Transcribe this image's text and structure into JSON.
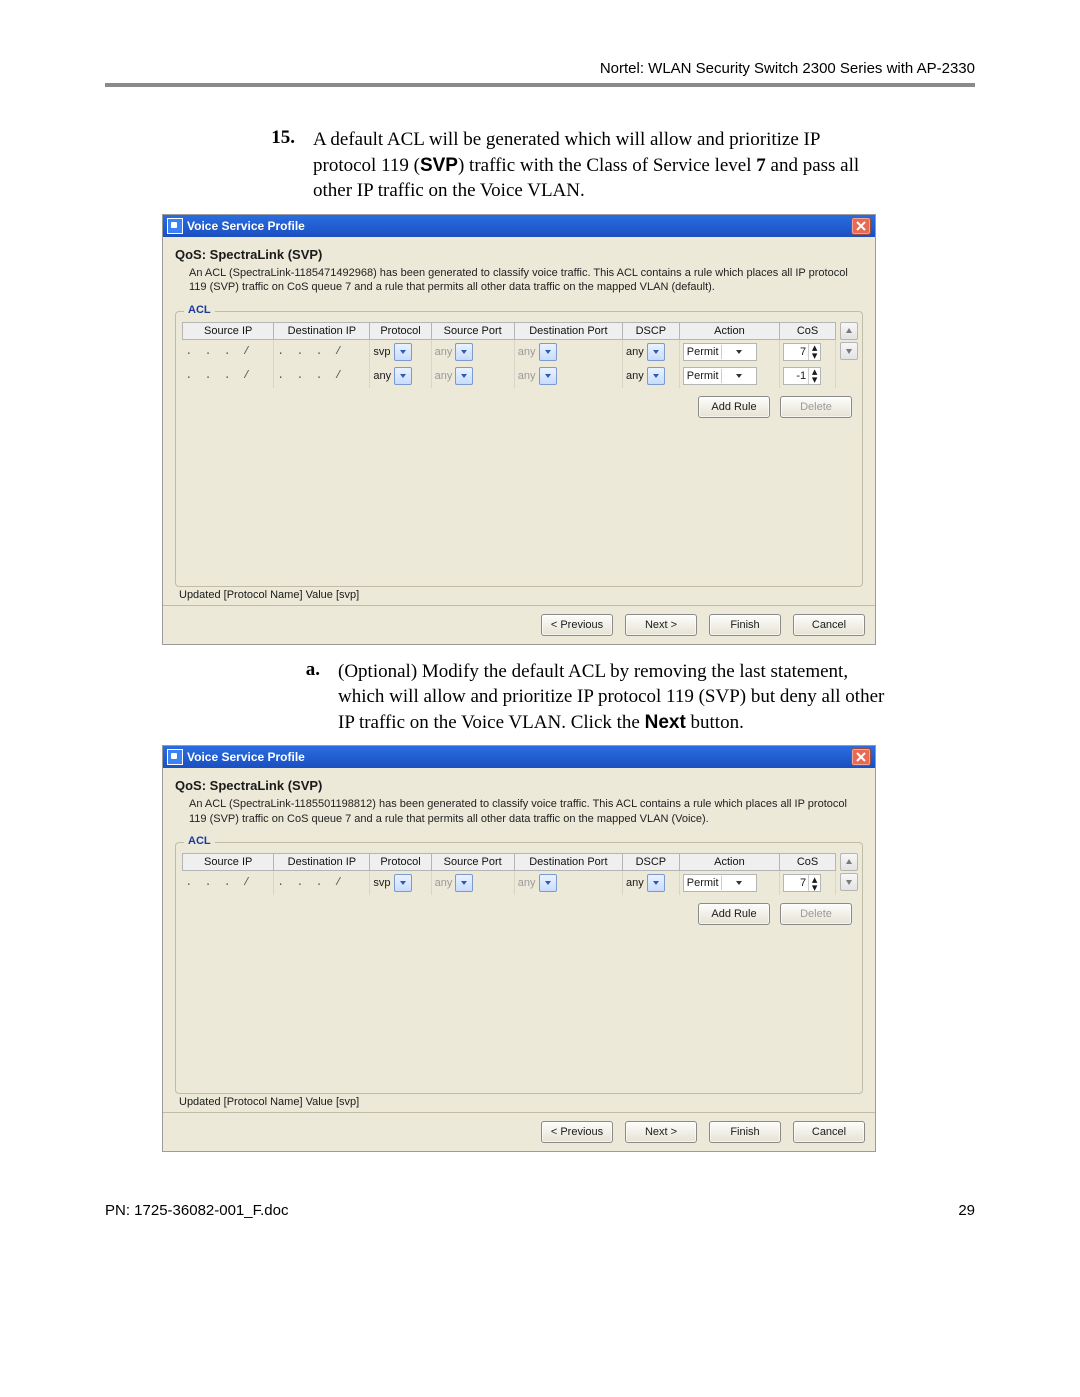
{
  "header": {
    "running": "Nortel: WLAN Security Switch 2300 Series with AP-2330"
  },
  "item15": {
    "number": "15.",
    "pre": "A default ACL will be generated which will allow and prioritize IP protocol 119 (",
    "svp": "SVP",
    "mid": ") traffic with the Class of Service level ",
    "seven": "7",
    "post": " and pass all other IP traffic on the Voice VLAN."
  },
  "sub_a": {
    "number": "a.",
    "text1": "(Optional) Modify the default ACL by removing the last statement, which will allow and prioritize IP protocol 119 (SVP) but deny all other IP traffic on the Voice VLAN. Click the ",
    "next_label": "Next",
    "text2": " button."
  },
  "dlg1": {
    "title": "Voice Service Profile",
    "qos": "QoS: SpectraLink (SVP)",
    "desc": "An ACL (SpectraLink-1185471492968) has been generated to classify voice traffic. This ACL contains a rule which places all IP protocol 119 (SVP) traffic on CoS queue 7 and a rule that permits all other data traffic on the mapped VLAN (default).",
    "legend": "ACL",
    "cols": [
      "Source IP",
      "Destination IP",
      "Protocol",
      "Source Port",
      "Destination Port",
      "DSCP",
      "Action",
      "CoS"
    ],
    "rows": [
      {
        "src": ". . . /",
        "dst": ". . . /",
        "proto": "svp",
        "sport": "any",
        "dport": "any",
        "dscp": "any",
        "action": "Permit",
        "cos": "7"
      },
      {
        "src": ". . . /",
        "dst": ". . . /",
        "proto": "any",
        "sport": "any",
        "dport": "any",
        "dscp": "any",
        "action": "Permit",
        "cos": "-1"
      }
    ],
    "add_rule": "Add Rule",
    "delete": "Delete",
    "status": "Updated [Protocol Name] Value [svp]",
    "prev": "< Previous",
    "next": "Next >",
    "finish": "Finish",
    "cancel": "Cancel"
  },
  "dlg2": {
    "title": "Voice Service Profile",
    "qos": "QoS: SpectraLink (SVP)",
    "desc": "An ACL (SpectraLink-1185501198812) has been generated to classify voice traffic. This ACL contains a rule which places all IP protocol 119 (SVP) traffic on CoS queue 7 and a rule that permits all other data traffic on the mapped VLAN (Voice).",
    "legend": "ACL",
    "cols": [
      "Source IP",
      "Destination IP",
      "Protocol",
      "Source Port",
      "Destination Port",
      "DSCP",
      "Action",
      "CoS"
    ],
    "rows": [
      {
        "src": ". . . /",
        "dst": ". . . /",
        "proto": "svp",
        "sport": "any",
        "dport": "any",
        "dscp": "any",
        "action": "Permit",
        "cos": "7"
      }
    ],
    "add_rule": "Add Rule",
    "delete": "Delete",
    "status": "Updated [Protocol Name] Value [svp]",
    "prev": "< Previous",
    "next": "Next >",
    "finish": "Finish",
    "cancel": "Cancel"
  },
  "footer": {
    "pn": "PN: 1725-36082-001_F.doc",
    "page": "29"
  }
}
